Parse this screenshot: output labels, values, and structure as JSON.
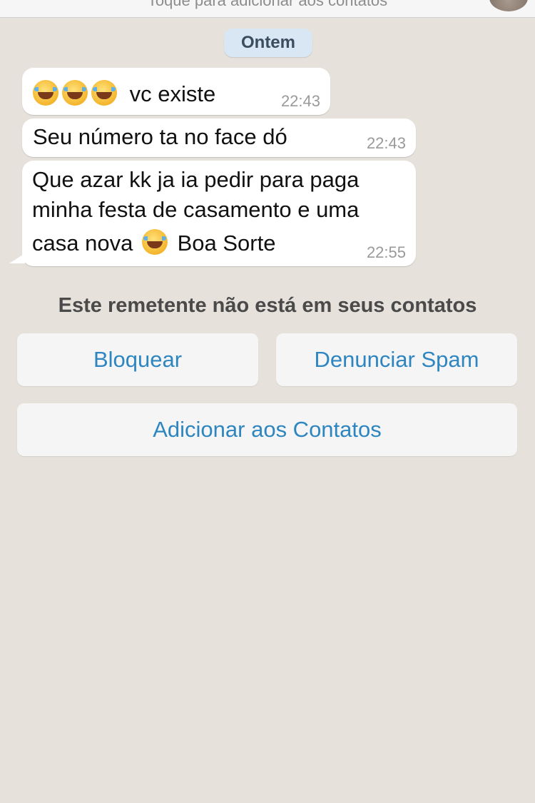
{
  "header": {
    "subtitle": "Toque para adicionar aos contatos"
  },
  "chat": {
    "date_label": "Ontem",
    "messages": [
      {
        "emoji": [
          "face-with-tears-of-joy",
          "face-with-tears-of-joy",
          "face-with-tears-of-joy"
        ],
        "text": "vc existe",
        "time": "22:43"
      },
      {
        "text": "Seu número ta no face dó",
        "time": "22:43"
      },
      {
        "line1": "Que azar kk ja ia pedir para paga",
        "line2": "minha festa de casamento e uma",
        "line3_before": "casa nova",
        "emoji": "face-with-tears-of-joy",
        "line3_after": "Boa Sorte",
        "time": "22:55"
      }
    ]
  },
  "unknown_sender": {
    "notice": "Este remetente não está em seus contatos",
    "block_label": "Bloquear",
    "report_label": "Denunciar Spam",
    "add_label": "Adicionar aos Contatos"
  },
  "colors": {
    "background": "#e6e1db",
    "bubble": "#ffffff",
    "date_pill": "#d9e6f4",
    "link_blue": "#2e86c1"
  }
}
